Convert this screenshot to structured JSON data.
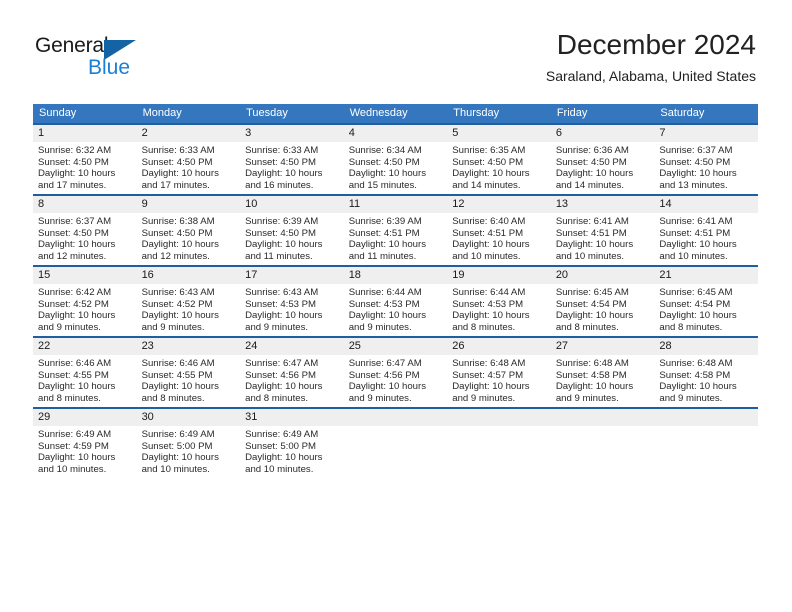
{
  "brand": {
    "name_part1": "General",
    "name_part2": "Blue",
    "triangle_color": "#1464a5",
    "blue_text_color": "#1b7fd4"
  },
  "header": {
    "title": "December 2024",
    "subtitle": "Saraland, Alabama, United States"
  },
  "theme": {
    "header_row_bg": "#3577bf",
    "week_divider": "#1f5fa0",
    "day_number_bg": "#efefef",
    "text": "#222222"
  },
  "calendar": {
    "weekday_headers": [
      "Sunday",
      "Monday",
      "Tuesday",
      "Wednesday",
      "Thursday",
      "Friday",
      "Saturday"
    ],
    "weeks": [
      [
        {
          "day": "1",
          "sunrise": "Sunrise: 6:32 AM",
          "sunset": "Sunset: 4:50 PM",
          "daylight_line1": "Daylight: 10 hours",
          "daylight_line2": "and 17 minutes."
        },
        {
          "day": "2",
          "sunrise": "Sunrise: 6:33 AM",
          "sunset": "Sunset: 4:50 PM",
          "daylight_line1": "Daylight: 10 hours",
          "daylight_line2": "and 17 minutes."
        },
        {
          "day": "3",
          "sunrise": "Sunrise: 6:33 AM",
          "sunset": "Sunset: 4:50 PM",
          "daylight_line1": "Daylight: 10 hours",
          "daylight_line2": "and 16 minutes."
        },
        {
          "day": "4",
          "sunrise": "Sunrise: 6:34 AM",
          "sunset": "Sunset: 4:50 PM",
          "daylight_line1": "Daylight: 10 hours",
          "daylight_line2": "and 15 minutes."
        },
        {
          "day": "5",
          "sunrise": "Sunrise: 6:35 AM",
          "sunset": "Sunset: 4:50 PM",
          "daylight_line1": "Daylight: 10 hours",
          "daylight_line2": "and 14 minutes."
        },
        {
          "day": "6",
          "sunrise": "Sunrise: 6:36 AM",
          "sunset": "Sunset: 4:50 PM",
          "daylight_line1": "Daylight: 10 hours",
          "daylight_line2": "and 14 minutes."
        },
        {
          "day": "7",
          "sunrise": "Sunrise: 6:37 AM",
          "sunset": "Sunset: 4:50 PM",
          "daylight_line1": "Daylight: 10 hours",
          "daylight_line2": "and 13 minutes."
        }
      ],
      [
        {
          "day": "8",
          "sunrise": "Sunrise: 6:37 AM",
          "sunset": "Sunset: 4:50 PM",
          "daylight_line1": "Daylight: 10 hours",
          "daylight_line2": "and 12 minutes."
        },
        {
          "day": "9",
          "sunrise": "Sunrise: 6:38 AM",
          "sunset": "Sunset: 4:50 PM",
          "daylight_line1": "Daylight: 10 hours",
          "daylight_line2": "and 12 minutes."
        },
        {
          "day": "10",
          "sunrise": "Sunrise: 6:39 AM",
          "sunset": "Sunset: 4:50 PM",
          "daylight_line1": "Daylight: 10 hours",
          "daylight_line2": "and 11 minutes."
        },
        {
          "day": "11",
          "sunrise": "Sunrise: 6:39 AM",
          "sunset": "Sunset: 4:51 PM",
          "daylight_line1": "Daylight: 10 hours",
          "daylight_line2": "and 11 minutes."
        },
        {
          "day": "12",
          "sunrise": "Sunrise: 6:40 AM",
          "sunset": "Sunset: 4:51 PM",
          "daylight_line1": "Daylight: 10 hours",
          "daylight_line2": "and 10 minutes."
        },
        {
          "day": "13",
          "sunrise": "Sunrise: 6:41 AM",
          "sunset": "Sunset: 4:51 PM",
          "daylight_line1": "Daylight: 10 hours",
          "daylight_line2": "and 10 minutes."
        },
        {
          "day": "14",
          "sunrise": "Sunrise: 6:41 AM",
          "sunset": "Sunset: 4:51 PM",
          "daylight_line1": "Daylight: 10 hours",
          "daylight_line2": "and 10 minutes."
        }
      ],
      [
        {
          "day": "15",
          "sunrise": "Sunrise: 6:42 AM",
          "sunset": "Sunset: 4:52 PM",
          "daylight_line1": "Daylight: 10 hours",
          "daylight_line2": "and 9 minutes."
        },
        {
          "day": "16",
          "sunrise": "Sunrise: 6:43 AM",
          "sunset": "Sunset: 4:52 PM",
          "daylight_line1": "Daylight: 10 hours",
          "daylight_line2": "and 9 minutes."
        },
        {
          "day": "17",
          "sunrise": "Sunrise: 6:43 AM",
          "sunset": "Sunset: 4:53 PM",
          "daylight_line1": "Daylight: 10 hours",
          "daylight_line2": "and 9 minutes."
        },
        {
          "day": "18",
          "sunrise": "Sunrise: 6:44 AM",
          "sunset": "Sunset: 4:53 PM",
          "daylight_line1": "Daylight: 10 hours",
          "daylight_line2": "and 9 minutes."
        },
        {
          "day": "19",
          "sunrise": "Sunrise: 6:44 AM",
          "sunset": "Sunset: 4:53 PM",
          "daylight_line1": "Daylight: 10 hours",
          "daylight_line2": "and 8 minutes."
        },
        {
          "day": "20",
          "sunrise": "Sunrise: 6:45 AM",
          "sunset": "Sunset: 4:54 PM",
          "daylight_line1": "Daylight: 10 hours",
          "daylight_line2": "and 8 minutes."
        },
        {
          "day": "21",
          "sunrise": "Sunrise: 6:45 AM",
          "sunset": "Sunset: 4:54 PM",
          "daylight_line1": "Daylight: 10 hours",
          "daylight_line2": "and 8 minutes."
        }
      ],
      [
        {
          "day": "22",
          "sunrise": "Sunrise: 6:46 AM",
          "sunset": "Sunset: 4:55 PM",
          "daylight_line1": "Daylight: 10 hours",
          "daylight_line2": "and 8 minutes."
        },
        {
          "day": "23",
          "sunrise": "Sunrise: 6:46 AM",
          "sunset": "Sunset: 4:55 PM",
          "daylight_line1": "Daylight: 10 hours",
          "daylight_line2": "and 8 minutes."
        },
        {
          "day": "24",
          "sunrise": "Sunrise: 6:47 AM",
          "sunset": "Sunset: 4:56 PM",
          "daylight_line1": "Daylight: 10 hours",
          "daylight_line2": "and 8 minutes."
        },
        {
          "day": "25",
          "sunrise": "Sunrise: 6:47 AM",
          "sunset": "Sunset: 4:56 PM",
          "daylight_line1": "Daylight: 10 hours",
          "daylight_line2": "and 9 minutes."
        },
        {
          "day": "26",
          "sunrise": "Sunrise: 6:48 AM",
          "sunset": "Sunset: 4:57 PM",
          "daylight_line1": "Daylight: 10 hours",
          "daylight_line2": "and 9 minutes."
        },
        {
          "day": "27",
          "sunrise": "Sunrise: 6:48 AM",
          "sunset": "Sunset: 4:58 PM",
          "daylight_line1": "Daylight: 10 hours",
          "daylight_line2": "and 9 minutes."
        },
        {
          "day": "28",
          "sunrise": "Sunrise: 6:48 AM",
          "sunset": "Sunset: 4:58 PM",
          "daylight_line1": "Daylight: 10 hours",
          "daylight_line2": "and 9 minutes."
        }
      ],
      [
        {
          "day": "29",
          "sunrise": "Sunrise: 6:49 AM",
          "sunset": "Sunset: 4:59 PM",
          "daylight_line1": "Daylight: 10 hours",
          "daylight_line2": "and 10 minutes."
        },
        {
          "day": "30",
          "sunrise": "Sunrise: 6:49 AM",
          "sunset": "Sunset: 5:00 PM",
          "daylight_line1": "Daylight: 10 hours",
          "daylight_line2": "and 10 minutes."
        },
        {
          "day": "31",
          "sunrise": "Sunrise: 6:49 AM",
          "sunset": "Sunset: 5:00 PM",
          "daylight_line1": "Daylight: 10 hours",
          "daylight_line2": "and 10 minutes."
        },
        {
          "day": "",
          "sunrise": "",
          "sunset": "",
          "daylight_line1": "",
          "daylight_line2": ""
        },
        {
          "day": "",
          "sunrise": "",
          "sunset": "",
          "daylight_line1": "",
          "daylight_line2": ""
        },
        {
          "day": "",
          "sunrise": "",
          "sunset": "",
          "daylight_line1": "",
          "daylight_line2": ""
        },
        {
          "day": "",
          "sunrise": "",
          "sunset": "",
          "daylight_line1": "",
          "daylight_line2": ""
        }
      ]
    ]
  }
}
